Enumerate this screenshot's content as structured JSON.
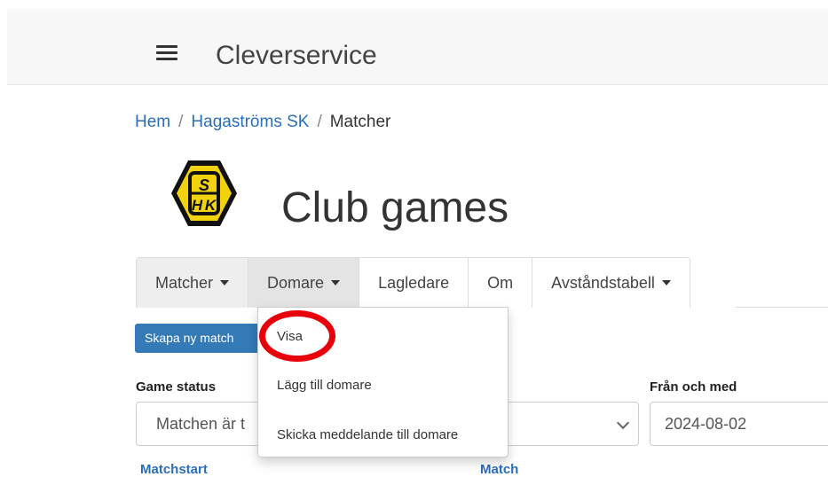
{
  "header": {
    "brand": "Cleverservice",
    "menu_icon": "hamburger-menu-icon"
  },
  "breadcrumb": {
    "items": [
      "Hem",
      "Hagaströms SK"
    ],
    "separator": "/",
    "current": "Matcher"
  },
  "club": {
    "logo_text": "HSK",
    "logo_colors": {
      "fill": "#f2d20c",
      "stroke": "#111111"
    },
    "page_title": "Club games"
  },
  "tabs": [
    {
      "label": "Matcher",
      "has_caret": true
    },
    {
      "label": "Domare",
      "has_caret": true
    },
    {
      "label": "Lagledare",
      "has_caret": false
    },
    {
      "label": "Om",
      "has_caret": false
    },
    {
      "label": "Avståndstabell",
      "has_caret": true
    }
  ],
  "dropdown": {
    "items": [
      "Visa",
      "Lägg till domare",
      "Skicka meddelande till domare"
    ]
  },
  "actions": {
    "create_match": "Skapa ny match"
  },
  "filters": {
    "status_label": "Game status",
    "status_value": "Matchen är t",
    "from_label": "Från och med",
    "from_value": "2024-08-02"
  },
  "table": {
    "columns": [
      "Matchstart",
      "Match"
    ]
  },
  "colors": {
    "link": "#2a6ebb",
    "primary_button": "#337ab7",
    "highlight_ring": "#e8000b"
  }
}
